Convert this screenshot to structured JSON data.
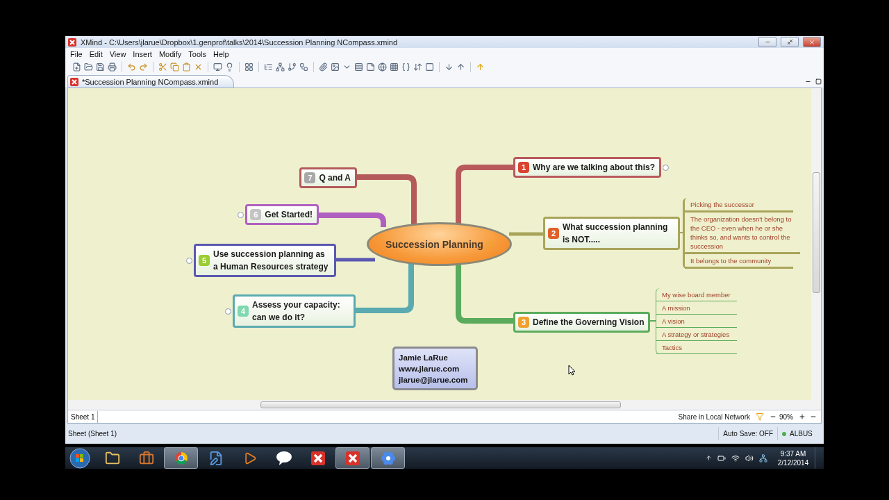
{
  "window": {
    "title": "XMind - C:\\Users\\jlarue\\Dropbox\\1.genprof\\talks\\2014\\Succession Planning NCompass.xmind"
  },
  "menu": [
    "File",
    "Edit",
    "View",
    "Insert",
    "Modify",
    "Tools",
    "Help"
  ],
  "editor_tab": {
    "label": "*Succession Planning NCompass.xmind",
    "selected": true
  },
  "map": {
    "central": {
      "label": "Succession Planning"
    },
    "right_topics": [
      {
        "number": "1",
        "label": "Why are we talking about this?",
        "color": "#b85a5c",
        "collapsed": true
      },
      {
        "number": "2",
        "label": "What succession planning is NOT.....",
        "color": "#a8a45a",
        "collapsed": false,
        "children": [
          {
            "label": "Picking the successor"
          },
          {
            "label": "The organization doesn't belong to the CEO - even when he or she thinks so, and wants to control the succession"
          },
          {
            "label": "It belongs to the community"
          }
        ]
      },
      {
        "number": "3",
        "label": "Define the Governing Vision",
        "color": "#5aab5c",
        "collapsed": false,
        "children": [
          {
            "label": "My wise board member"
          },
          {
            "label": "A mission"
          },
          {
            "label": "A vision"
          },
          {
            "label": "A strategy or strategies"
          },
          {
            "label": "Tactics"
          }
        ]
      }
    ],
    "left_topics": [
      {
        "number": "7",
        "label": "Q and A",
        "color": "#b45a5a",
        "collapsed": false
      },
      {
        "number": "6",
        "label": "Get Started!",
        "color": "#b060c0",
        "collapsed": true
      },
      {
        "number": "5",
        "label": "Use succession planning as a Human Resources strategy",
        "color": "#5a58b0",
        "collapsed": true
      },
      {
        "number": "4",
        "label": "Assess your capacity: can we do it?",
        "color": "#5aaab0",
        "collapsed": true
      }
    ],
    "note_box": {
      "lines": [
        "Jamie LaRue",
        "www.jlarue.com",
        "jlarue@jlarue.com"
      ]
    }
  },
  "sheet_tabs": [
    {
      "label": "Sheet 1",
      "selected": true
    }
  ],
  "share": "Share in Local Network",
  "zoom": "90%",
  "status": {
    "sheet": "Sheet (Sheet 1)",
    "autosave": "Auto Save: OFF",
    "user": "ALBUS"
  },
  "clock": {
    "time": "9:37 AM",
    "date": "2/12/2014"
  }
}
